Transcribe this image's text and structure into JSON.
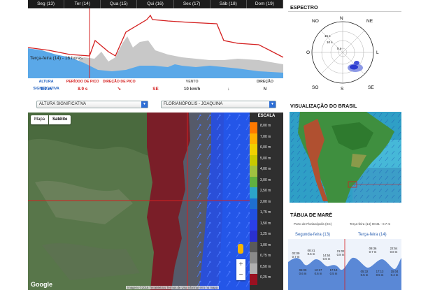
{
  "days": [
    "Seg (13)",
    "Ter (14)",
    "Qua (15)",
    "Qui (16)",
    "Sex (17)",
    "Sáb (18)",
    "Dom (19)"
  ],
  "chart_note": "Terça-feira (14) - 16 horas",
  "readings": [
    {
      "label": "ALTURA SIGNIFICATIVA",
      "value": "1.2 m",
      "color": "#1f5fbf"
    },
    {
      "label": "PERÍODO DE PICO",
      "value": "8.9 s",
      "color": "#d42020"
    },
    {
      "label": "DIREÇÃO DE PICO",
      "value": "",
      "color": "#d42020"
    },
    {
      "label": "",
      "value": "SE",
      "color": "#d42020"
    },
    {
      "label": "VENTO",
      "value": "10 km/h",
      "color": "#666666"
    },
    {
      "label": "",
      "value": "",
      "color": "#444444"
    },
    {
      "label": "DIREÇÃO",
      "value": "N",
      "color": "#444444"
    }
  ],
  "selects": {
    "variable": "ALTURA SIGNIFICATIVA",
    "location": "FLORIANÓPOLIS - JOAQUINA"
  },
  "map": {
    "btn_map": "Mapa",
    "btn_satellite": "Satélite",
    "zoom_in": "+",
    "zoom_out": "−",
    "logo": "Google",
    "credit": "Imagens ©2016 TerraMetrics   Termos de Uso   Informar erro no mapa"
  },
  "scale": {
    "title": "ESCALA",
    "levels": [
      "8,00 m",
      "7,00 m",
      "6,00 m",
      "5,00 m",
      "4,00 m",
      "3,00 m",
      "2,50 m",
      "2,00 m",
      "1,75 m",
      "1,50 m",
      "1,25 m",
      "1,00 m",
      "0,75 m",
      "0,50 m",
      "0,25 m"
    ],
    "colors": [
      "#ff7a00",
      "#ffb000",
      "#f0d000",
      "#c8c800",
      "#a0c040",
      "#60b040",
      "#2ca4c8",
      "#1e6fd0",
      "#2050e0",
      "#2a3fe8",
      "#2a30d0",
      "#5a5a5a",
      "#8a8a8a",
      "#b0b0b0",
      "#9a1020"
    ]
  },
  "espectro": {
    "title": "ESPECTRO",
    "dirs": {
      "n": "NO",
      "n2": "N",
      "ne": "NE",
      "o": "O",
      "l": "L",
      "so": "SO",
      "s": "S",
      "se": "SE"
    },
    "rings": [
      "15 s",
      "10 s",
      "5 s"
    ]
  },
  "brasil": {
    "title": "VISUALIZAÇÃO DO BRASIL"
  },
  "mare": {
    "title": "TÁBUA DE MARÉ",
    "port": "Porto de Florianópolis (SC)",
    "now": "Terça-feira (14) 00:31 - 0.7 m",
    "day1": "Segunda-feira (13)",
    "day2": "Terça-feira (14)",
    "highs": [
      {
        "time": "02:09",
        "h": "0.7 m"
      },
      {
        "time": "08:41",
        "h": "0.6 m"
      },
      {
        "time": "14:54",
        "h": "0.6 m"
      },
      {
        "time": "21:02",
        "h": "0.8 m"
      },
      {
        "time": "09:36",
        "h": "0.7 m"
      },
      {
        "time": "22:54",
        "h": "0.8 m"
      }
    ],
    "lows": [
      {
        "time": "05:09",
        "h": "0.6 m"
      },
      {
        "time": "12:17",
        "h": "0.6 m"
      },
      {
        "time": "17:13",
        "h": "0.5 m"
      },
      {
        "time": "05:32",
        "h": "0.5 m"
      },
      {
        "time": "17:13",
        "h": "0.5 m"
      },
      {
        "time": "15:04",
        "h": "0.4 m"
      }
    ]
  }
}
